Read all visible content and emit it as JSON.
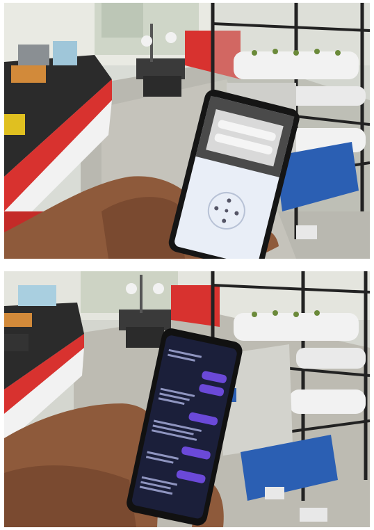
{
  "photos": [
    {
      "id_label": "top-photo",
      "scene": "lab-hydroponics-phone-camera-app",
      "phone_time": "",
      "colors": {
        "phone_screen": "#e9eef7",
        "hand": "#8e5a3b",
        "table_red": "#d8322f",
        "pipes": "#f2f2f2",
        "water_tank": "#2b5fb3"
      }
    },
    {
      "id_label": "bottom-photo",
      "scene": "lab-hydroponics-phone-chat-app",
      "colors": {
        "phone_screen": "#1b1f3a",
        "chat_bubble": "#6b49d8",
        "hand": "#8e5a3b",
        "table_red": "#d8322f",
        "water_tank": "#2b5fb3"
      }
    }
  ]
}
